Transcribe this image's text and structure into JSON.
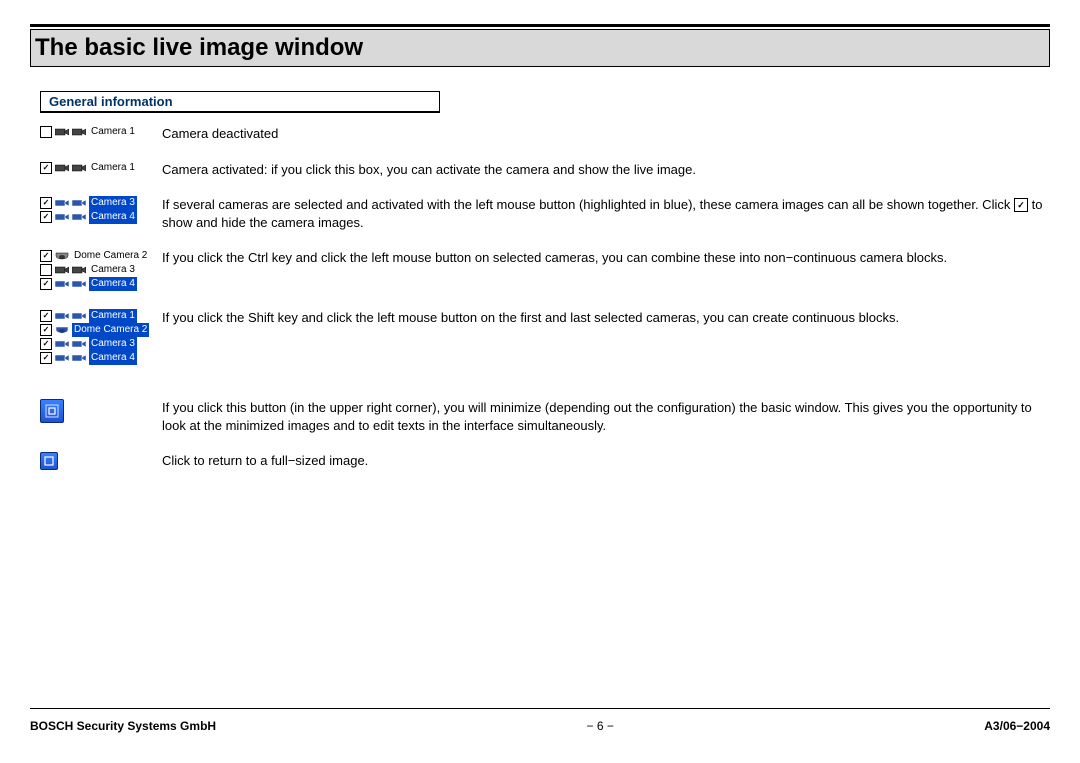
{
  "title": "The basic live image window",
  "section_header": "General information",
  "rows": {
    "r1_label": "Camera 1",
    "r1_text": "Camera deactivated",
    "r2_label": "Camera 1",
    "r2_text": "Camera activated:  if you click this box, you can activate the camera and show the live image.",
    "r3_label1": "Camera 3",
    "r3_label2": "Camera 4",
    "r3_text_a": "If several cameras are selected and activated with the left mouse button (highlighted in blue), these camera images can all be shown together. Click ",
    "r3_text_b": "  to show and hide the camera images.",
    "r4_label1": "Dome Camera 2",
    "r4_label2": "Camera 3",
    "r4_label3": "Camera 4",
    "r4_text": "If you click the Ctrl key and click the left mouse button on selected cameras, you can combine these into non−continuous camera blocks.",
    "r5_label1": "Camera 1",
    "r5_label2": "Dome Camera 2",
    "r5_label3": "Camera 3",
    "r5_label4": "Camera 4",
    "r5_text": "If you click the Shift key and click the left mouse button on the first and last selected cameras, you can create continuous blocks.",
    "r6_text": "If you click this button (in the upper right corner), you will minimize (depending out the configuration)  the basic window. This gives you the opportunity to look at the minimized images and to edit texts in the interface simultaneously.",
    "r7_text": "Click to return to a full−sized image."
  },
  "footer": {
    "left": "BOSCH Security Systems GmbH",
    "center": "− 6 −",
    "right": "A3/06−2004"
  }
}
